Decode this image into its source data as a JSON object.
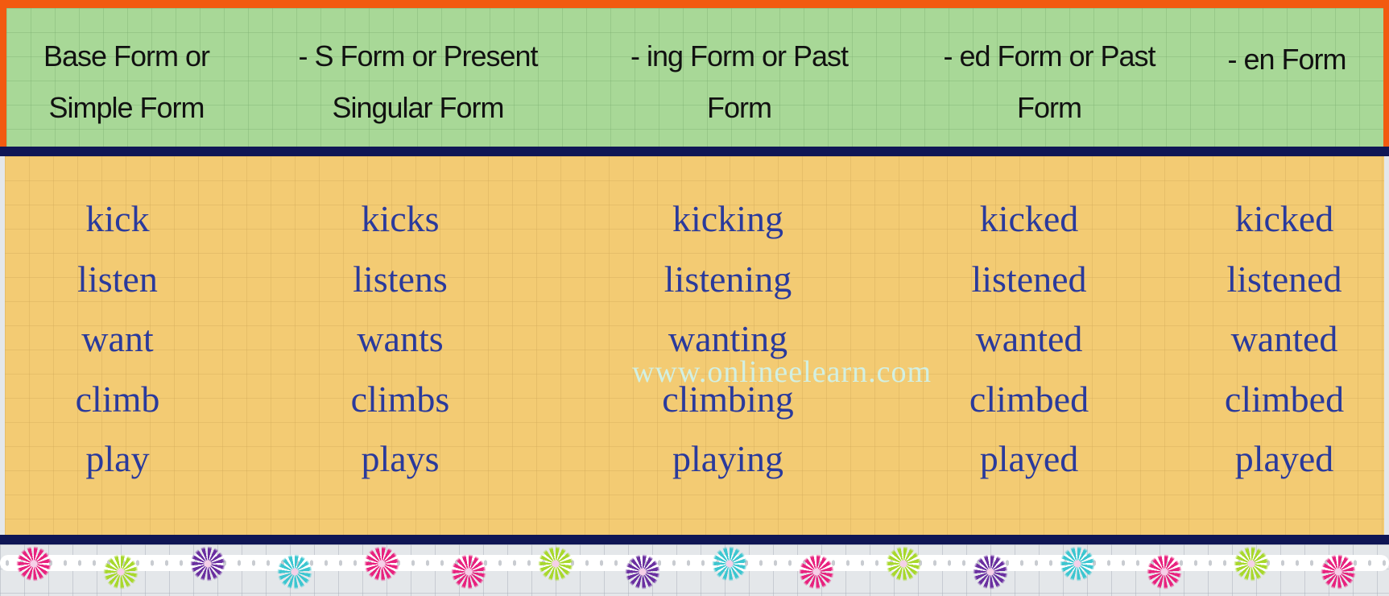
{
  "headers": [
    [
      "Base Form or",
      "Simple Form"
    ],
    [
      "- S Form or Present",
      "Singular Form"
    ],
    [
      "- ing Form or Past",
      "Form"
    ],
    [
      "- ed Form or Past",
      "Form"
    ],
    [
      "- en Form",
      ""
    ]
  ],
  "columns": [
    [
      "kick",
      "listen",
      "want",
      "climb",
      "play"
    ],
    [
      "kicks",
      "listens",
      "wants",
      "climbs",
      "plays"
    ],
    [
      "kicking",
      "listening",
      "wanting",
      "climbing",
      "playing"
    ],
    [
      "kicked",
      "listened",
      "wanted",
      "climbed",
      "played"
    ],
    [
      "kicked",
      "listened",
      "wanted",
      "climbed",
      "played"
    ]
  ],
  "watermark": "www.onlineelearn.com",
  "colors": {
    "border_orange": "#f25a10",
    "header_green": "#a8d897",
    "body_yellow": "#f3cb73",
    "divider_navy": "#0f1655",
    "word_blue": "#2a3a9c",
    "flowers": [
      "#e8227e",
      "#a8d82c",
      "#6a2fa0",
      "#3cc6d0"
    ]
  }
}
